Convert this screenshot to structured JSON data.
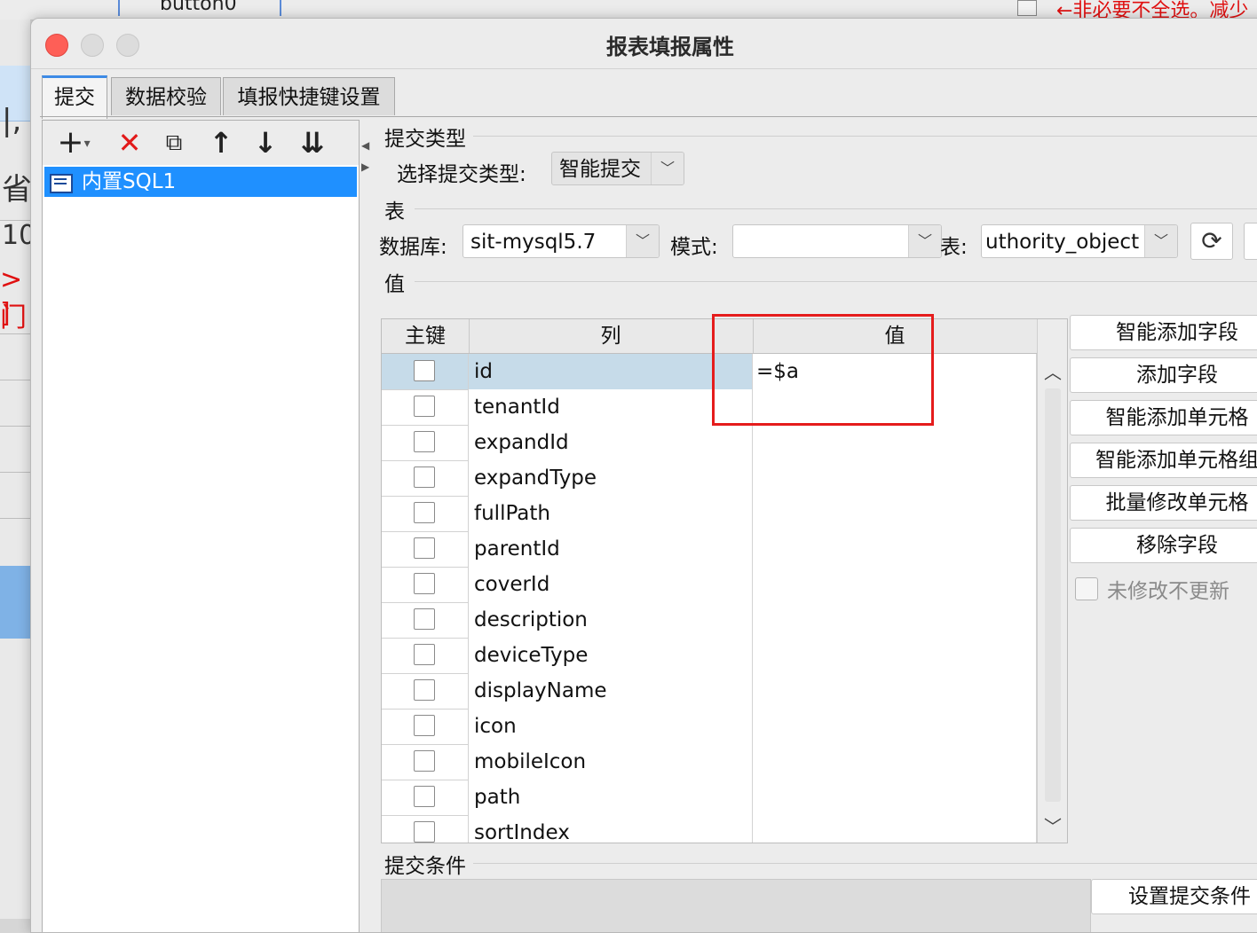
{
  "background": {
    "button_label": "button0",
    "red_note": "←非必要不全选。减少",
    "left_fragments": [
      "|,",
      "省",
      "10",
      ">门",
      "]"
    ]
  },
  "dialog": {
    "title": "报表填报属性",
    "tabs": [
      "提交",
      "数据校验",
      "填报快捷键设置"
    ]
  },
  "left_panel": {
    "toolbar": {
      "add": "+",
      "add_caret": "▾",
      "delete": "✕",
      "copy": "⧉",
      "move_up": "↑",
      "move_down": "↓",
      "move_bottom": "⇊"
    },
    "items": [
      {
        "label": "内置SQL1",
        "icon": "sql-icon"
      }
    ]
  },
  "submit_type": {
    "section_label": "提交类型",
    "select_label": "选择提交类型:",
    "value": "智能提交"
  },
  "table_section": {
    "section_label": "表",
    "db_label": "数据库:",
    "db_value": "sit-mysql5.7",
    "schema_label": "模式:",
    "schema_value": "",
    "table_label": "表:",
    "table_value": "uthority_object"
  },
  "values_section": {
    "section_label": "值",
    "columns": [
      "主键",
      "列",
      "值"
    ],
    "rows": [
      {
        "column": "id",
        "value": "=$a"
      },
      {
        "column": "tenantId",
        "value": ""
      },
      {
        "column": "expandId",
        "value": ""
      },
      {
        "column": "expandType",
        "value": ""
      },
      {
        "column": "fullPath",
        "value": ""
      },
      {
        "column": "parentId",
        "value": ""
      },
      {
        "column": "coverId",
        "value": ""
      },
      {
        "column": "description",
        "value": ""
      },
      {
        "column": "deviceType",
        "value": ""
      },
      {
        "column": "displayName",
        "value": ""
      },
      {
        "column": "icon",
        "value": ""
      },
      {
        "column": "mobileIcon",
        "value": ""
      },
      {
        "column": "path",
        "value": ""
      },
      {
        "column": "sortIndex",
        "value": ""
      }
    ],
    "buttons": [
      "智能添加字段",
      "添加字段",
      "智能添加单元格",
      "智能添加单元格组",
      "批量修改单元格",
      "移除字段"
    ],
    "no_update_label": "未修改不更新"
  },
  "condition_section": {
    "section_label": "提交条件",
    "button_label": "设置提交条件"
  },
  "colors": {
    "accent": "#1f90ff",
    "selected_row": "#c6dbe9",
    "highlight_box": "#e51c1c"
  }
}
